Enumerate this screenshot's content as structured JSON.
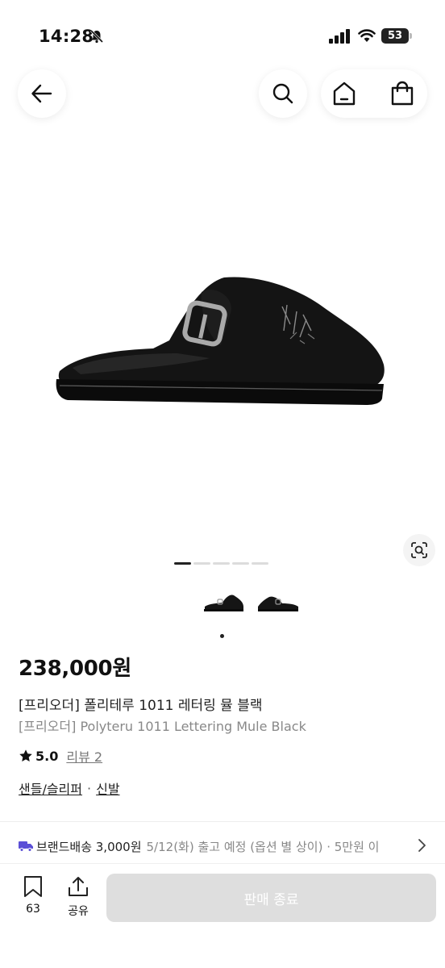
{
  "status_bar": {
    "time": "14:28",
    "battery": "53"
  },
  "product": {
    "price": "238,000원",
    "name_ko": "[프리오더] 폴리테루 1011 레터링 뮬 블랙",
    "name_en": "[프리오더] Polyteru 1011 Lettering Mule Black",
    "rating": "5.0",
    "review_link": "리뷰 2",
    "categories": [
      "샌들/슬리퍼",
      "신발"
    ],
    "category_separator": "·"
  },
  "gallery": {
    "slide_count": 5,
    "active_index": 0
  },
  "shipping": {
    "label": "브랜드배송 3,000원",
    "info": "5/12(화) 출고 예정 (옵션 별 상이) · 5만원 이"
  },
  "bottom_bar": {
    "bookmark_count": "63",
    "share_label": "공유",
    "buy_button": "판매 종료"
  },
  "icons": {
    "back": "arrow-left-icon",
    "search": "search-icon",
    "home": "home-icon",
    "bag": "shopping-bag-icon",
    "lens": "visual-search-icon",
    "bookmark": "bookmark-icon",
    "share": "share-icon",
    "truck": "truck-icon",
    "chevron": "chevron-right-icon",
    "star": "star-icon"
  },
  "colors": {
    "truck": "#5b4fd6",
    "button_disabled": "#dedede",
    "text_muted": "#888888"
  }
}
